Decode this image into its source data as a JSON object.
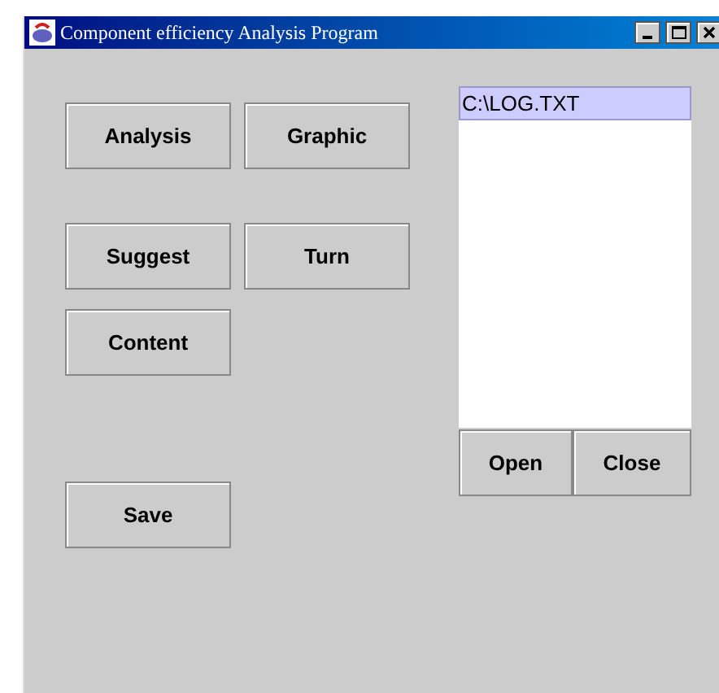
{
  "window": {
    "title": "Component efficiency Analysis Program"
  },
  "buttons": [
    {
      "label": "Analysis"
    },
    {
      "label": "Graphic"
    },
    {
      "label": "Suggest"
    },
    {
      "label": "Turn"
    },
    {
      "label": "Content"
    },
    {
      "label": "Save"
    }
  ],
  "file_list": {
    "items": [
      {
        "label": "C:\\LOG.TXT",
        "selected": true
      }
    ]
  },
  "list_buttons": [
    {
      "label": "Open"
    },
    {
      "label": "Close"
    }
  ]
}
